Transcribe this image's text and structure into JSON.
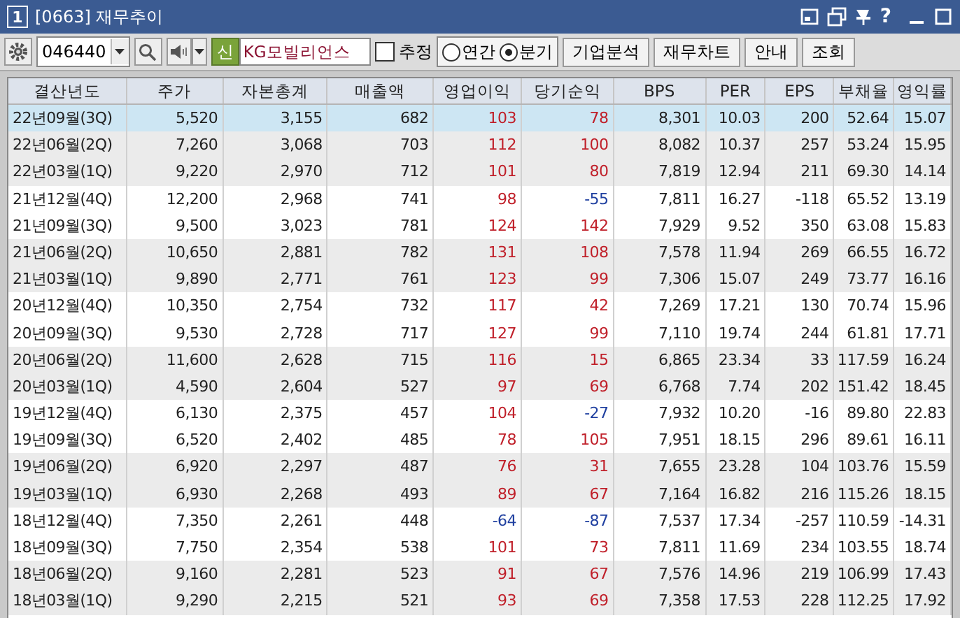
{
  "window": {
    "number": "1",
    "title": "[0663] 재무추이",
    "help": "?"
  },
  "toolbar": {
    "code": "046440",
    "badge": "신",
    "company": "KG모빌리언스",
    "estimate": {
      "label": "추정",
      "checked": false
    },
    "period": [
      {
        "label": "연간",
        "selected": false
      },
      {
        "label": "분기",
        "selected": true
      }
    ],
    "buttons": [
      "기업분석",
      "재무차트",
      "안내",
      "조회"
    ]
  },
  "table": {
    "columns": [
      "결산년도",
      "주가",
      "자본총계",
      "매출액",
      "영업이익",
      "당기순익",
      "BPS",
      "PER",
      "EPS",
      "부채율",
      "영익률"
    ],
    "rows": [
      {
        "selected": true,
        "cells": [
          "22년09월(3Q)",
          "5,520",
          "3,155",
          "682",
          "103",
          "78",
          "8,301",
          "10.03",
          "200",
          "52.64",
          "15.07"
        ]
      },
      {
        "selected": false,
        "cells": [
          "22년06월(2Q)",
          "7,260",
          "3,068",
          "703",
          "112",
          "100",
          "8,082",
          "10.37",
          "257",
          "53.24",
          "15.95"
        ]
      },
      {
        "selected": false,
        "cells": [
          "22년03월(1Q)",
          "9,220",
          "2,970",
          "712",
          "101",
          "80",
          "7,819",
          "12.94",
          "211",
          "69.30",
          "14.14"
        ]
      },
      {
        "selected": false,
        "cells": [
          "21년12월(4Q)",
          "12,200",
          "2,968",
          "741",
          "98",
          "-55",
          "7,811",
          "16.27",
          "-118",
          "65.52",
          "13.19"
        ]
      },
      {
        "selected": false,
        "cells": [
          "21년09월(3Q)",
          "9,500",
          "3,023",
          "781",
          "124",
          "142",
          "7,929",
          "9.52",
          "350",
          "63.08",
          "15.83"
        ]
      },
      {
        "selected": false,
        "cells": [
          "21년06월(2Q)",
          "10,650",
          "2,881",
          "782",
          "131",
          "108",
          "7,578",
          "11.94",
          "269",
          "66.55",
          "16.72"
        ]
      },
      {
        "selected": false,
        "cells": [
          "21년03월(1Q)",
          "9,890",
          "2,771",
          "761",
          "123",
          "99",
          "7,306",
          "15.07",
          "249",
          "73.77",
          "16.16"
        ]
      },
      {
        "selected": false,
        "cells": [
          "20년12월(4Q)",
          "10,350",
          "2,754",
          "732",
          "117",
          "42",
          "7,269",
          "17.21",
          "130",
          "70.74",
          "15.96"
        ]
      },
      {
        "selected": false,
        "cells": [
          "20년09월(3Q)",
          "9,530",
          "2,728",
          "717",
          "127",
          "99",
          "7,110",
          "19.74",
          "244",
          "61.81",
          "17.71"
        ]
      },
      {
        "selected": false,
        "cells": [
          "20년06월(2Q)",
          "11,600",
          "2,628",
          "715",
          "116",
          "15",
          "6,865",
          "23.34",
          "33",
          "117.59",
          "16.24"
        ]
      },
      {
        "selected": false,
        "cells": [
          "20년03월(1Q)",
          "4,590",
          "2,604",
          "527",
          "97",
          "69",
          "6,768",
          "7.74",
          "202",
          "151.42",
          "18.45"
        ]
      },
      {
        "selected": false,
        "cells": [
          "19년12월(4Q)",
          "6,130",
          "2,375",
          "457",
          "104",
          "-27",
          "7,932",
          "10.20",
          "-16",
          "89.80",
          "22.83"
        ]
      },
      {
        "selected": false,
        "cells": [
          "19년09월(3Q)",
          "6,520",
          "2,402",
          "485",
          "78",
          "105",
          "7,951",
          "18.15",
          "296",
          "89.61",
          "16.11"
        ]
      },
      {
        "selected": false,
        "cells": [
          "19년06월(2Q)",
          "6,920",
          "2,297",
          "487",
          "76",
          "31",
          "7,655",
          "23.28",
          "104",
          "103.76",
          "15.59"
        ]
      },
      {
        "selected": false,
        "cells": [
          "19년03월(1Q)",
          "6,930",
          "2,268",
          "493",
          "89",
          "67",
          "7,164",
          "16.82",
          "216",
          "115.26",
          "18.15"
        ]
      },
      {
        "selected": false,
        "cells": [
          "18년12월(4Q)",
          "7,350",
          "2,261",
          "448",
          "-64",
          "-87",
          "7,537",
          "17.34",
          "-257",
          "110.59",
          "-14.31"
        ]
      },
      {
        "selected": false,
        "cells": [
          "18년09월(3Q)",
          "7,750",
          "2,354",
          "538",
          "101",
          "73",
          "7,811",
          "11.69",
          "234",
          "103.55",
          "18.74"
        ]
      },
      {
        "selected": false,
        "cells": [
          "18년06월(2Q)",
          "9,160",
          "2,281",
          "523",
          "91",
          "67",
          "7,576",
          "14.96",
          "219",
          "106.99",
          "17.43"
        ]
      },
      {
        "selected": false,
        "cells": [
          "18년03월(1Q)",
          "9,290",
          "2,215",
          "521",
          "93",
          "69",
          "7,358",
          "17.53",
          "228",
          "112.25",
          "17.92"
        ]
      }
    ]
  }
}
